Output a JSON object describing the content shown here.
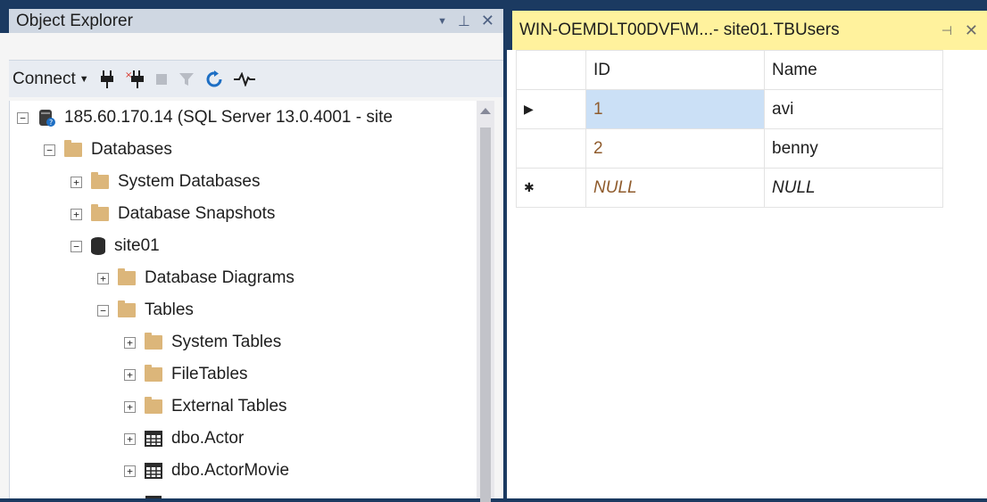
{
  "object_explorer": {
    "title": "Object Explorer",
    "controls": {
      "dropdown": "▼",
      "pin": "⊥",
      "close": "✕"
    },
    "toolbar": {
      "connect_label": "Connect"
    },
    "tree": [
      {
        "label": "185.60.170.14 (SQL Server 13.0.4001 - site",
        "level": 0,
        "expander": "−",
        "icon": "server-icon"
      },
      {
        "label": "Databases",
        "level": 1,
        "expander": "−",
        "icon": "folder-icon"
      },
      {
        "label": "System Databases",
        "level": 2,
        "expander": "+",
        "icon": "folder-icon"
      },
      {
        "label": "Database Snapshots",
        "level": 2,
        "expander": "+",
        "icon": "folder-icon"
      },
      {
        "label": "site01",
        "level": 2,
        "expander": "−",
        "icon": "database-icon"
      },
      {
        "label": "Database Diagrams",
        "level": 3,
        "expander": "+",
        "icon": "folder-icon"
      },
      {
        "label": "Tables",
        "level": 3,
        "expander": "−",
        "icon": "folder-icon"
      },
      {
        "label": "System Tables",
        "level": 4,
        "expander": "+",
        "icon": "folder-icon"
      },
      {
        "label": "FileTables",
        "level": 4,
        "expander": "+",
        "icon": "folder-icon"
      },
      {
        "label": "External Tables",
        "level": 4,
        "expander": "+",
        "icon": "folder-icon"
      },
      {
        "label": "dbo.Actor",
        "level": 4,
        "expander": "+",
        "icon": "table-icon"
      },
      {
        "label": "dbo.ActorMovie",
        "level": 4,
        "expander": "+",
        "icon": "table-icon"
      }
    ]
  },
  "document": {
    "tab_label": "WIN-OEMDLT00DVF\\M...- site01.TBUsers",
    "tab_pin": "⊣",
    "tab_close": "✕",
    "columns": [
      "ID",
      "Name"
    ],
    "rows": [
      {
        "indicator": "▶",
        "id": "1",
        "name": "avi"
      },
      {
        "indicator": "",
        "id": "2",
        "name": "benny"
      },
      {
        "indicator": "✱",
        "id": "NULL",
        "name": "NULL"
      }
    ]
  },
  "colors": {
    "window_frame": "#1b3a61",
    "active_tab": "#fff29d",
    "selected_cell": "#cbe0f6",
    "folder": "#dcb67a"
  }
}
